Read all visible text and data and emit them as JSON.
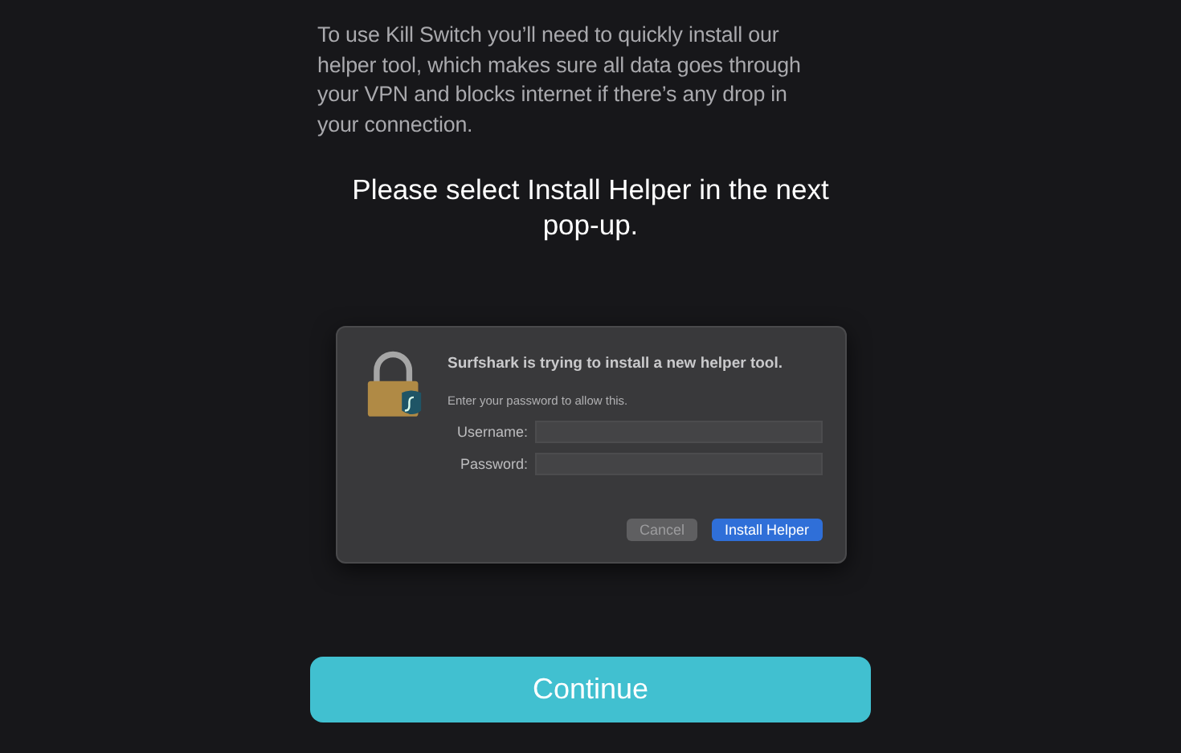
{
  "description": "To use Kill Switch you’ll need to quickly install our helper tool, which makes sure all data goes through your VPN and blocks internet if there’s any drop in your connection.",
  "instruction": "Please select Install Helper in the next pop-up.",
  "dialog": {
    "title": "Surfshark is trying to install a new helper tool.",
    "message": "Enter your password to allow this.",
    "fields": [
      {
        "label": "Username:"
      },
      {
        "label": "Password:"
      }
    ],
    "buttons": [
      {
        "label": "Cancel",
        "kind": "secondary"
      },
      {
        "label": "Install Helper",
        "kind": "primary"
      }
    ]
  },
  "continue_button": {
    "label": "Continue"
  }
}
